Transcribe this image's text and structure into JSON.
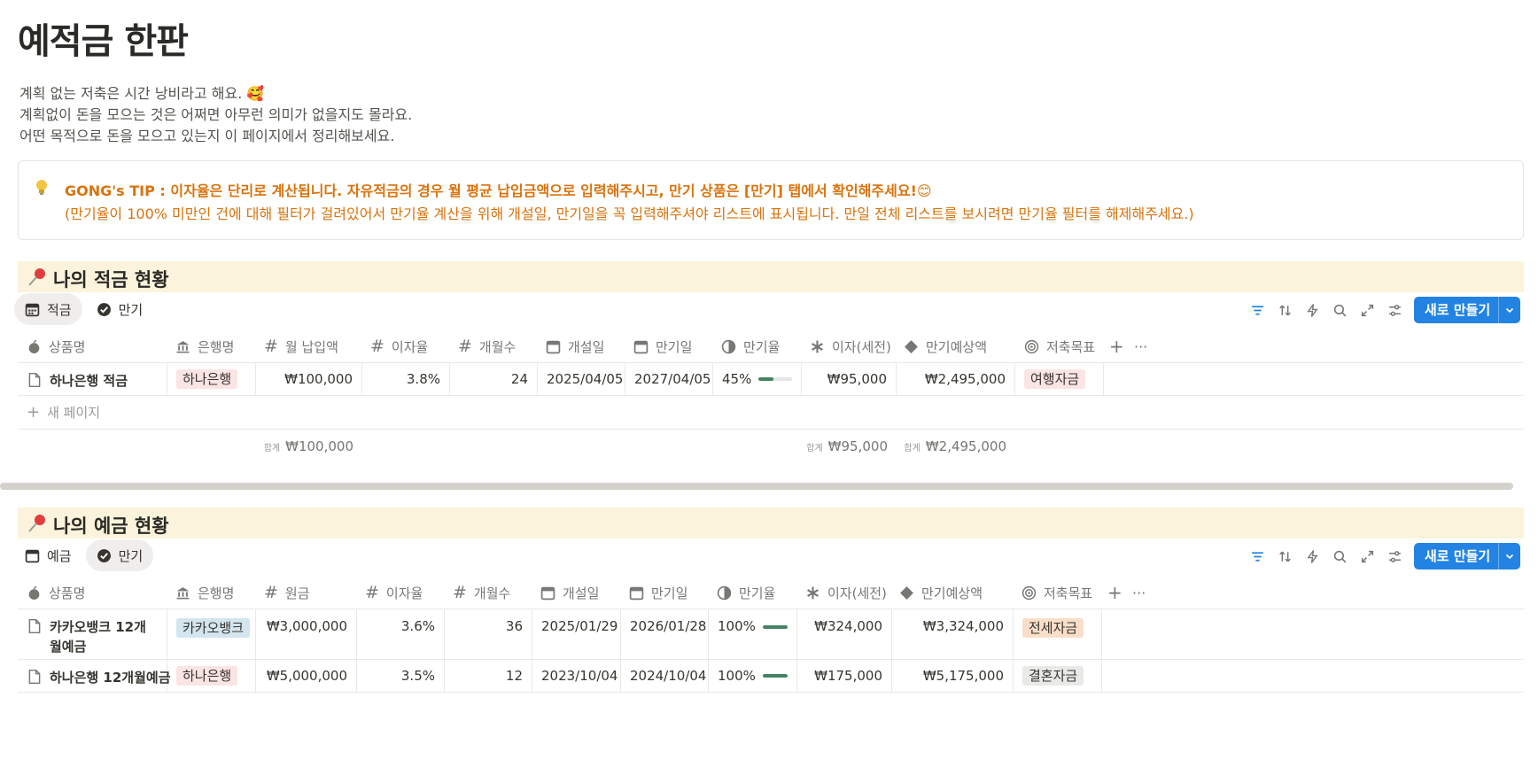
{
  "page": {
    "title": "예적금 한판",
    "description": [
      "계획 없는 저축은 시간 낭비라고 해요.",
      "계획없이 돈을 모으는 것은 어쩌면 아무런 의미가 없을지도 몰라요.",
      "어떤 목적으로 돈을 모으고 있는지 이 페이지에서 정리해보세요."
    ]
  },
  "callout": {
    "icon": "lightbulb-icon",
    "line1": "GONG's TIP : 이자율은 단리로 계산됩니다. 자유적금의 경우 월 평균 납입금액으로 입력해주시고, 만기 상품은 [만기] 탭에서 확인해주세요!",
    "line2": "(만기율이 100% 미만인 건에 대해 필터가 걸려있어서 만기율 계산을 위해 개설일, 만기일을 꼭 입력해주셔야 리스트에 표시됩니다. 만일 전체 리스트를 보시려면 만기율 필터를 해제해주세요.)",
    "color": "#d9730d"
  },
  "savings": {
    "title": "나의 적금 현황",
    "tabs": [
      {
        "label": "적금",
        "active": true
      },
      {
        "label": "만기",
        "active": false
      }
    ],
    "new_button": "새로 만들기",
    "headers": [
      "상품명",
      "은행명",
      "월 납입액",
      "이자율",
      "개월수",
      "개설일",
      "만기일",
      "만기율",
      "이자(세전)",
      "만기예상액",
      "저축목표"
    ],
    "rows": [
      {
        "name": "하나은행 적금",
        "bank": "하나은행",
        "amount": "₩100,000",
        "rate": "3.8%",
        "months": "24",
        "open": "2025/04/05",
        "maturity": "2027/04/05",
        "progress_label": "45%",
        "progress": 0.45,
        "interest": "₩95,000",
        "expected": "₩2,495,000",
        "goal": "여행자금"
      }
    ],
    "new_page": "새 페이지",
    "sum_label": "합계",
    "sums": {
      "amount": "₩100,000",
      "interest": "₩95,000",
      "expected": "₩2,495,000"
    }
  },
  "deposits": {
    "title": "나의 예금 현황",
    "tabs": [
      {
        "label": "예금",
        "active": false
      },
      {
        "label": "만기",
        "active": true
      }
    ],
    "new_button": "새로 만들기",
    "headers": [
      "상품명",
      "은행명",
      "원금",
      "이자율",
      "개월수",
      "개설일",
      "만기일",
      "만기율",
      "이자(세전)",
      "만기예상액",
      "저축목표"
    ],
    "rows": [
      {
        "name": "카카오뱅크 12개월예금",
        "bank": "카카오뱅크",
        "amount": "₩3,000,000",
        "rate": "3.6%",
        "months": "36",
        "open": "2025/01/29",
        "maturity": "2026/01/28",
        "progress_label": "100%",
        "progress": 1.0,
        "interest": "₩324,000",
        "expected": "₩3,324,000",
        "goal": "전세자금"
      },
      {
        "name": "하나은행 12개월예금",
        "bank": "하나은행",
        "amount": "₩5,000,000",
        "rate": "3.5%",
        "months": "12",
        "open": "2023/10/04",
        "maturity": "2024/10/04",
        "progress_label": "100%",
        "progress": 1.0,
        "interest": "₩175,000",
        "expected": "₩5,175,000",
        "goal": "결혼자금"
      }
    ]
  },
  "colors": {
    "accent": "#2383e2",
    "header_bg": "#fbf3db",
    "tag_hana": "#fbe4e4",
    "tag_kakao": "#d3e5ef",
    "tag_travel": "#fbe4e4",
    "tag_jeonse": "#fadec9",
    "tag_wedding": "#e9e9e7",
    "progress_green": "#448361"
  }
}
